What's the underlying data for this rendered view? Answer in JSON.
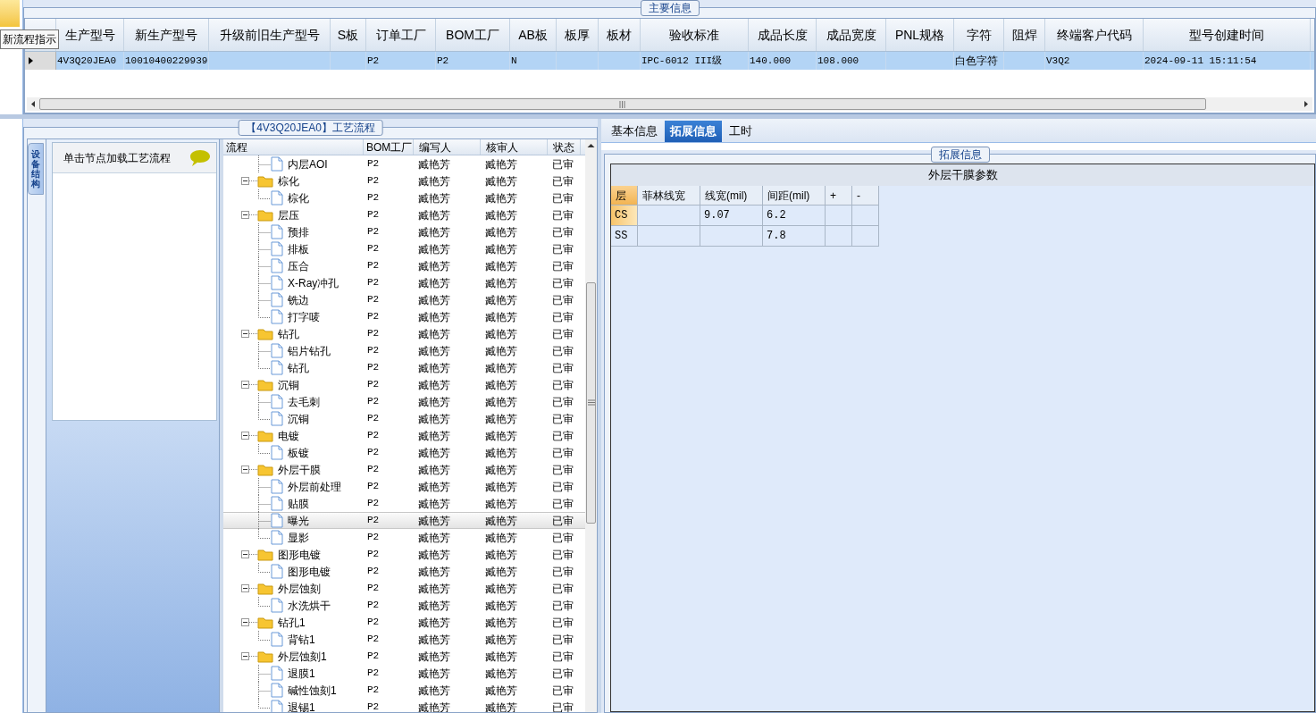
{
  "top_strip": {
    "tooltip": "新流程指示"
  },
  "main_info": {
    "title": "主要信息",
    "columns": [
      "生产型号",
      "新生产型号",
      "升级前旧生产型号",
      "S板",
      "订单工厂",
      "BOM工厂",
      "AB板",
      "板厚",
      "板材",
      "验收标准",
      "成品长度",
      "成品宽度",
      "PNL规格",
      "字符",
      "阻焊",
      "终端客户代码",
      "型号创建时间"
    ],
    "rows": [
      {
        "selected": true,
        "cells": [
          "4V3Q20JEA0",
          "10010400229939",
          null,
          null,
          "P2",
          "P2",
          "N",
          null,
          null,
          "IPC-6012 III级",
          "140.000",
          "108.000",
          null,
          "白色字符",
          null,
          "V3Q2",
          "2024-09-11 15:11:54"
        ]
      }
    ]
  },
  "process_panel": {
    "title": "【4V3Q20JEA0】工艺流程",
    "side_tab": "设备结构",
    "nav_header": "单击节点加载工艺流程",
    "columns": [
      "流程",
      "BOM工厂",
      "编写人",
      "核审人",
      "状态"
    ],
    "tree": [
      {
        "kind": "file",
        "label": "内层AOI",
        "selected": false,
        "factory": "P2",
        "writer": "臧艳芳",
        "reviewer": "臧艳芳",
        "status": "已审"
      },
      {
        "kind": "folder",
        "label": "棕化",
        "expanded": true,
        "selected": false,
        "factory": "P2",
        "writer": "臧艳芳",
        "reviewer": "臧艳芳",
        "status": "已审",
        "children": [
          {
            "kind": "file",
            "label": "棕化",
            "selected": false,
            "factory": "P2",
            "writer": "臧艳芳",
            "reviewer": "臧艳芳",
            "status": "已审"
          }
        ]
      },
      {
        "kind": "folder",
        "label": "层压",
        "expanded": true,
        "selected": false,
        "factory": "P2",
        "writer": "臧艳芳",
        "reviewer": "臧艳芳",
        "status": "已审",
        "children": [
          {
            "kind": "file",
            "label": "预排",
            "selected": false,
            "factory": "P2",
            "writer": "臧艳芳",
            "reviewer": "臧艳芳",
            "status": "已审"
          },
          {
            "kind": "file",
            "label": "排板",
            "selected": false,
            "factory": "P2",
            "writer": "臧艳芳",
            "reviewer": "臧艳芳",
            "status": "已审"
          },
          {
            "kind": "file",
            "label": "压合",
            "selected": false,
            "factory": "P2",
            "writer": "臧艳芳",
            "reviewer": "臧艳芳",
            "status": "已审"
          },
          {
            "kind": "file",
            "label": "X-Ray冲孔",
            "selected": false,
            "factory": "P2",
            "writer": "臧艳芳",
            "reviewer": "臧艳芳",
            "status": "已审"
          },
          {
            "kind": "file",
            "label": "铣边",
            "selected": false,
            "factory": "P2",
            "writer": "臧艳芳",
            "reviewer": "臧艳芳",
            "status": "已审"
          },
          {
            "kind": "file",
            "label": "打字唛",
            "selected": false,
            "factory": "P2",
            "writer": "臧艳芳",
            "reviewer": "臧艳芳",
            "status": "已审"
          }
        ]
      },
      {
        "kind": "folder",
        "label": "钻孔",
        "expanded": true,
        "selected": false,
        "factory": "P2",
        "writer": "臧艳芳",
        "reviewer": "臧艳芳",
        "status": "已审",
        "children": [
          {
            "kind": "file",
            "label": "铝片钻孔",
            "selected": false,
            "factory": "P2",
            "writer": "臧艳芳",
            "reviewer": "臧艳芳",
            "status": "已审"
          },
          {
            "kind": "file",
            "label": "钻孔",
            "selected": false,
            "factory": "P2",
            "writer": "臧艳芳",
            "reviewer": "臧艳芳",
            "status": "已审"
          }
        ]
      },
      {
        "kind": "folder",
        "label": "沉铜",
        "expanded": true,
        "selected": false,
        "factory": "P2",
        "writer": "臧艳芳",
        "reviewer": "臧艳芳",
        "status": "已审",
        "children": [
          {
            "kind": "file",
            "label": "去毛刺",
            "selected": false,
            "factory": "P2",
            "writer": "臧艳芳",
            "reviewer": "臧艳芳",
            "status": "已审"
          },
          {
            "kind": "file",
            "label": "沉铜",
            "selected": false,
            "factory": "P2",
            "writer": "臧艳芳",
            "reviewer": "臧艳芳",
            "status": "已审"
          }
        ]
      },
      {
        "kind": "folder",
        "label": "电镀",
        "expanded": true,
        "selected": false,
        "factory": "P2",
        "writer": "臧艳芳",
        "reviewer": "臧艳芳",
        "status": "已审",
        "children": [
          {
            "kind": "file",
            "label": "板镀",
            "selected": false,
            "factory": "P2",
            "writer": "臧艳芳",
            "reviewer": "臧艳芳",
            "status": "已审"
          }
        ]
      },
      {
        "kind": "folder",
        "label": "外层干膜",
        "expanded": true,
        "selected": false,
        "factory": "P2",
        "writer": "臧艳芳",
        "reviewer": "臧艳芳",
        "status": "已审",
        "children": [
          {
            "kind": "file",
            "label": "外层前处理",
            "selected": false,
            "factory": "P2",
            "writer": "臧艳芳",
            "reviewer": "臧艳芳",
            "status": "已审"
          },
          {
            "kind": "file",
            "label": "贴膜",
            "selected": false,
            "factory": "P2",
            "writer": "臧艳芳",
            "reviewer": "臧艳芳",
            "status": "已审"
          },
          {
            "kind": "file",
            "label": "曝光",
            "selected": true,
            "factory": "P2",
            "writer": "臧艳芳",
            "reviewer": "臧艳芳",
            "status": "已审"
          },
          {
            "kind": "file",
            "label": "显影",
            "selected": false,
            "factory": "P2",
            "writer": "臧艳芳",
            "reviewer": "臧艳芳",
            "status": "已审"
          }
        ]
      },
      {
        "kind": "folder",
        "label": "图形电镀",
        "expanded": true,
        "selected": false,
        "factory": "P2",
        "writer": "臧艳芳",
        "reviewer": "臧艳芳",
        "status": "已审",
        "children": [
          {
            "kind": "file",
            "label": "图形电镀",
            "selected": false,
            "factory": "P2",
            "writer": "臧艳芳",
            "reviewer": "臧艳芳",
            "status": "已审"
          }
        ]
      },
      {
        "kind": "folder",
        "label": "外层蚀刻",
        "expanded": true,
        "selected": false,
        "factory": "P2",
        "writer": "臧艳芳",
        "reviewer": "臧艳芳",
        "status": "已审",
        "children": [
          {
            "kind": "file",
            "label": "水洗烘干",
            "selected": false,
            "factory": "P2",
            "writer": "臧艳芳",
            "reviewer": "臧艳芳",
            "status": "已审"
          }
        ]
      },
      {
        "kind": "folder",
        "label": "钻孔1",
        "expanded": true,
        "selected": false,
        "factory": "P2",
        "writer": "臧艳芳",
        "reviewer": "臧艳芳",
        "status": "已审",
        "children": [
          {
            "kind": "file",
            "label": "背钻1",
            "selected": false,
            "factory": "P2",
            "writer": "臧艳芳",
            "reviewer": "臧艳芳",
            "status": "已审"
          }
        ]
      },
      {
        "kind": "folder",
        "label": "外层蚀刻1",
        "expanded": true,
        "selected": false,
        "factory": "P2",
        "writer": "臧艳芳",
        "reviewer": "臧艳芳",
        "status": "已审",
        "children": [
          {
            "kind": "file",
            "label": "退膜1",
            "selected": false,
            "factory": "P2",
            "writer": "臧艳芳",
            "reviewer": "臧艳芳",
            "status": "已审"
          },
          {
            "kind": "file",
            "label": "碱性蚀刻1",
            "selected": false,
            "factory": "P2",
            "writer": "臧艳芳",
            "reviewer": "臧艳芳",
            "status": "已审"
          },
          {
            "kind": "file",
            "label": "退锡1",
            "selected": false,
            "factory": "P2",
            "writer": "臧艳芳",
            "reviewer": "臧艳芳",
            "status": "已审"
          }
        ]
      }
    ]
  },
  "detail_tabs": [
    {
      "label": "基本信息",
      "selected": false
    },
    {
      "label": "拓展信息",
      "selected": true
    },
    {
      "label": "工时",
      "selected": false
    }
  ],
  "extended_info": {
    "title": "拓展信息",
    "caption": "外层干膜参数",
    "columns": [
      "层",
      "菲林线宽",
      "线宽(mil)",
      "间距(mil)",
      "+",
      "-"
    ],
    "rows": [
      {
        "selected": true,
        "cells": [
          "CS",
          null,
          "9.07",
          "6.2",
          null,
          null
        ]
      },
      {
        "selected": false,
        "cells": [
          "SS",
          null,
          null,
          "7.8",
          null,
          null
        ]
      }
    ]
  }
}
